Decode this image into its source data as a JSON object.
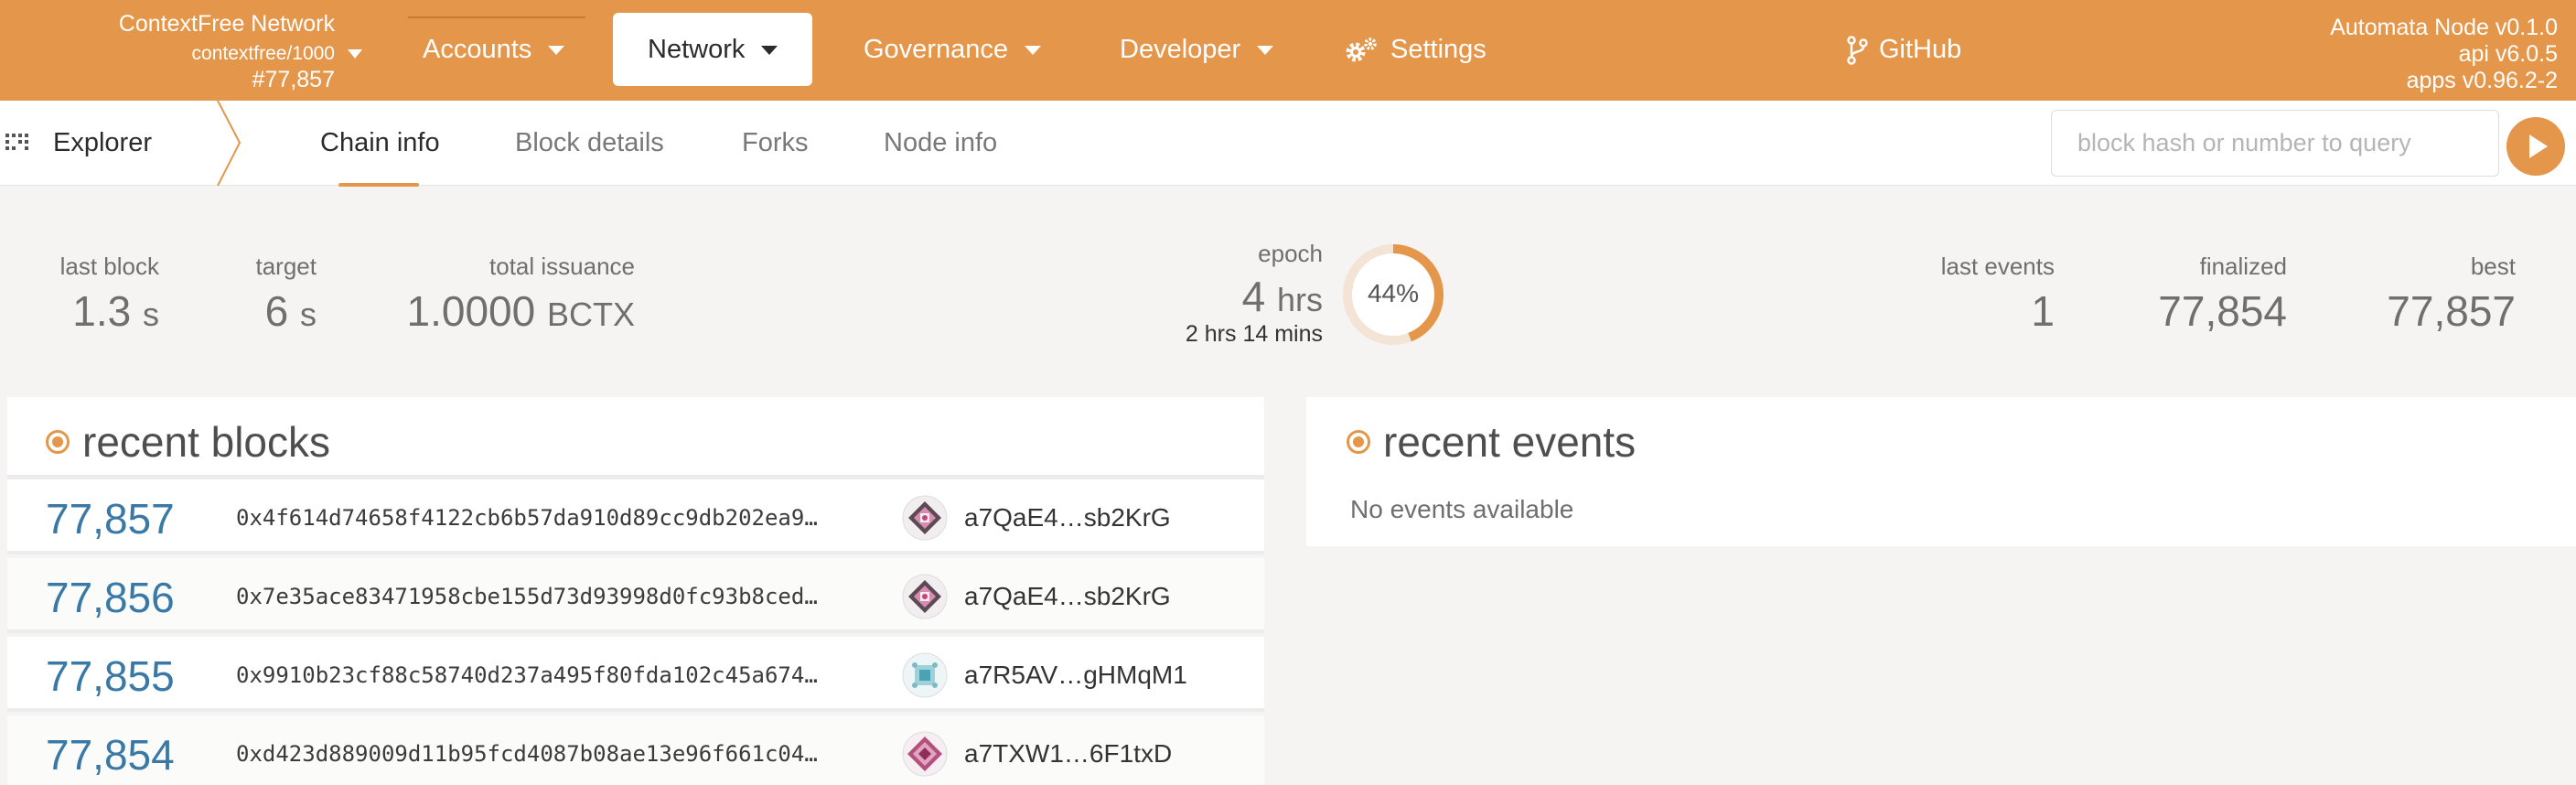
{
  "header": {
    "chain_name": "ContextFree Network",
    "spec": "contextfree/1000",
    "block": "#77,857",
    "menu": {
      "accounts": "Accounts",
      "network": "Network",
      "governance": "Governance",
      "developer": "Developer",
      "settings": "Settings",
      "github": "GitHub"
    },
    "node": {
      "name": "Automata Node v0.1.0",
      "api": "api v6.0.5",
      "apps": "apps v0.96.2-2"
    }
  },
  "subnav": {
    "section": "Explorer",
    "tabs": [
      "Chain info",
      "Block details",
      "Forks",
      "Node info"
    ],
    "active_tab": "Chain info",
    "search_placeholder": "block hash or number to query"
  },
  "summary": {
    "last_block": {
      "label": "last block",
      "value": "1.3",
      "unit": "s"
    },
    "target": {
      "label": "target",
      "value": "6",
      "unit": "s"
    },
    "total_issuance": {
      "label": "total issuance",
      "value": "1.0000",
      "unit": "BCTX"
    },
    "epoch": {
      "label": "epoch",
      "value": "4",
      "unit": "hrs",
      "remaining_hrs": "2",
      "hrs_unit": "hrs",
      "remaining_mins": "14",
      "mins_unit": "mins",
      "progress_text": "44%",
      "progress": 0.44
    },
    "last_events": {
      "label": "last events",
      "value": "1"
    },
    "finalized": {
      "label": "finalized",
      "value": "77,854"
    },
    "best": {
      "label": "best",
      "value": "77,857"
    }
  },
  "recent_blocks": {
    "title": "recent blocks",
    "rows": [
      {
        "number": "77,857",
        "hash": "0x4f614d74658f4122cb6b57da910d89cc9db202ea9…",
        "author": "a7QaE4…sb2KrG"
      },
      {
        "number": "77,856",
        "hash": "0x7e35ace83471958cbe155d73d93998d0fc93b8ced…",
        "author": "a7QaE4…sb2KrG"
      },
      {
        "number": "77,855",
        "hash": "0x9910b23cf88c58740d237a495f80fda102c45a674…",
        "author": "a7R5AV…gHMqM1"
      },
      {
        "number": "77,854",
        "hash": "0xd423d889009d11b95fcd4087b08ae13e96f661c04…",
        "author": "a7TXW1…6F1txD"
      }
    ]
  },
  "recent_events": {
    "title": "recent events",
    "empty_text": "No events available"
  },
  "colors": {
    "brand": "#e4964a",
    "link": "#3a79a6",
    "background": "#f5f4f3"
  },
  "icons": [
    "grid-icon",
    "gear-icon",
    "branch-icon",
    "play-icon",
    "identicon"
  ]
}
